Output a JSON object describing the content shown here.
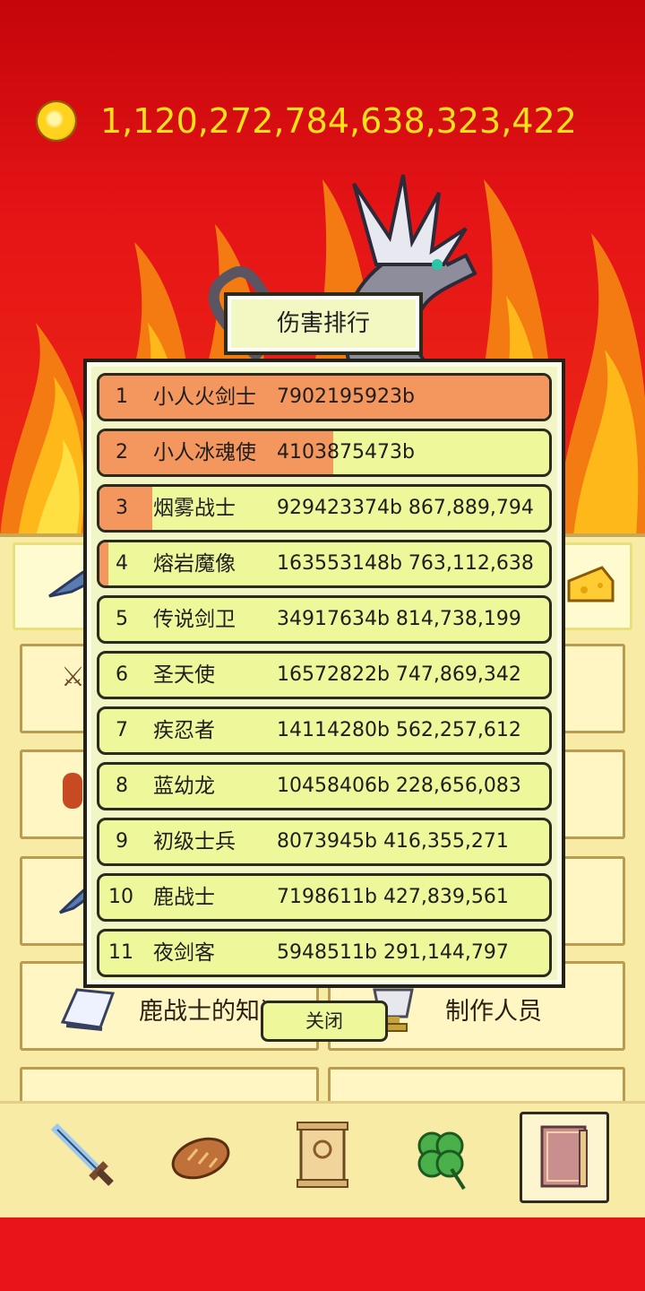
{
  "currency": {
    "icon": "gold-coin-icon",
    "amount": "1,120,272,784,638,323,422"
  },
  "boss": {
    "icon": "dragon-icon"
  },
  "popup": {
    "title": "伤害排行",
    "close_label": "关闭",
    "rows": [
      {
        "rank": "1",
        "name": "小人火剑士",
        "value": "7902195923b",
        "fill": 1.0
      },
      {
        "rank": "2",
        "name": "小人冰魂使",
        "value": "4103875473b",
        "fill": 0.52
      },
      {
        "rank": "3",
        "name": "烟雾战士",
        "value": "929423374b 867,889,794",
        "fill": 0.118
      },
      {
        "rank": "4",
        "name": "熔岩魔像",
        "value": "163553148b 763,112,638",
        "fill": 0.02
      },
      {
        "rank": "5",
        "name": "传说剑卫",
        "value": "34917634b 814,738,199",
        "fill": 0
      },
      {
        "rank": "6",
        "name": "圣天使",
        "value": "16572822b 747,869,342",
        "fill": 0
      },
      {
        "rank": "7",
        "name": "疾忍者",
        "value": "14114280b 562,257,612",
        "fill": 0
      },
      {
        "rank": "8",
        "name": "蓝幼龙",
        "value": "10458406b 228,656,083",
        "fill": 0
      },
      {
        "rank": "9",
        "name": "初级士兵",
        "value": "8073945b 416,355,271",
        "fill": 0
      },
      {
        "rank": "10",
        "name": "鹿战士",
        "value": "7198611b 427,839,561",
        "fill": 0
      },
      {
        "rank": "11",
        "name": "夜剑客",
        "value": "5948511b 291,144,797",
        "fill": 0
      }
    ]
  },
  "menu": {
    "knowledge_label": "鹿战士的知识",
    "credits_label": "制作人员"
  },
  "nav": [
    {
      "icon": "sword-icon",
      "active": false
    },
    {
      "icon": "bread-icon",
      "active": false
    },
    {
      "icon": "scroll-icon",
      "active": false
    },
    {
      "icon": "clover-icon",
      "active": false
    },
    {
      "icon": "book-icon",
      "active": true
    }
  ],
  "colors": {
    "background": "#e8141a",
    "gold_text": "#ffe21a",
    "row_bg": "#eef79a",
    "bar_fill": "#f4975e"
  }
}
